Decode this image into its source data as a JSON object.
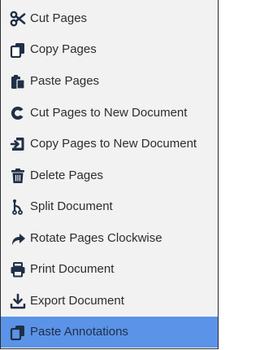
{
  "menu": {
    "items": [
      {
        "label": "Cut Pages",
        "icon": "scissors-icon"
      },
      {
        "label": "Copy Pages",
        "icon": "copy-icon"
      },
      {
        "label": "Paste Pages",
        "icon": "clipboard-icon"
      },
      {
        "label": "Cut Pages to New Document",
        "icon": "cut-to-new-icon"
      },
      {
        "label": "Copy Pages to New Document",
        "icon": "copy-to-new-icon"
      },
      {
        "label": "Delete Pages",
        "icon": "trash-icon"
      },
      {
        "label": "Split Document",
        "icon": "split-icon"
      },
      {
        "label": "Rotate Pages Clockwise",
        "icon": "rotate-clockwise-icon"
      },
      {
        "label": "Print Document",
        "icon": "printer-icon"
      },
      {
        "label": "Export Document",
        "icon": "download-icon"
      },
      {
        "label": "Paste Annotations",
        "icon": "paste-annotations-icon"
      }
    ],
    "highlighted_item": "Paste Annotations",
    "colors": {
      "background": "#f2f2f2",
      "highlight": "#5b93e8",
      "icon": "#1f2f45",
      "text": "#2d2d2d"
    }
  }
}
